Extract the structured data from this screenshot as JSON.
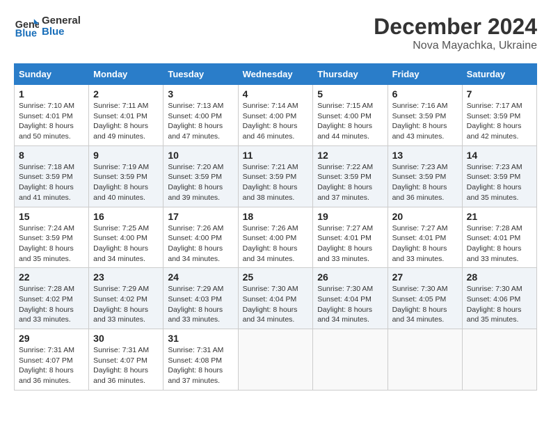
{
  "header": {
    "logo_line1": "General",
    "logo_line2": "Blue",
    "month_year": "December 2024",
    "location": "Nova Mayachka, Ukraine"
  },
  "weekdays": [
    "Sunday",
    "Monday",
    "Tuesday",
    "Wednesday",
    "Thursday",
    "Friday",
    "Saturday"
  ],
  "weeks": [
    [
      {
        "day": "1",
        "sunrise": "Sunrise: 7:10 AM",
        "sunset": "Sunset: 4:01 PM",
        "daylight": "Daylight: 8 hours and 50 minutes."
      },
      {
        "day": "2",
        "sunrise": "Sunrise: 7:11 AM",
        "sunset": "Sunset: 4:01 PM",
        "daylight": "Daylight: 8 hours and 49 minutes."
      },
      {
        "day": "3",
        "sunrise": "Sunrise: 7:13 AM",
        "sunset": "Sunset: 4:00 PM",
        "daylight": "Daylight: 8 hours and 47 minutes."
      },
      {
        "day": "4",
        "sunrise": "Sunrise: 7:14 AM",
        "sunset": "Sunset: 4:00 PM",
        "daylight": "Daylight: 8 hours and 46 minutes."
      },
      {
        "day": "5",
        "sunrise": "Sunrise: 7:15 AM",
        "sunset": "Sunset: 4:00 PM",
        "daylight": "Daylight: 8 hours and 44 minutes."
      },
      {
        "day": "6",
        "sunrise": "Sunrise: 7:16 AM",
        "sunset": "Sunset: 3:59 PM",
        "daylight": "Daylight: 8 hours and 43 minutes."
      },
      {
        "day": "7",
        "sunrise": "Sunrise: 7:17 AM",
        "sunset": "Sunset: 3:59 PM",
        "daylight": "Daylight: 8 hours and 42 minutes."
      }
    ],
    [
      {
        "day": "8",
        "sunrise": "Sunrise: 7:18 AM",
        "sunset": "Sunset: 3:59 PM",
        "daylight": "Daylight: 8 hours and 41 minutes."
      },
      {
        "day": "9",
        "sunrise": "Sunrise: 7:19 AM",
        "sunset": "Sunset: 3:59 PM",
        "daylight": "Daylight: 8 hours and 40 minutes."
      },
      {
        "day": "10",
        "sunrise": "Sunrise: 7:20 AM",
        "sunset": "Sunset: 3:59 PM",
        "daylight": "Daylight: 8 hours and 39 minutes."
      },
      {
        "day": "11",
        "sunrise": "Sunrise: 7:21 AM",
        "sunset": "Sunset: 3:59 PM",
        "daylight": "Daylight: 8 hours and 38 minutes."
      },
      {
        "day": "12",
        "sunrise": "Sunrise: 7:22 AM",
        "sunset": "Sunset: 3:59 PM",
        "daylight": "Daylight: 8 hours and 37 minutes."
      },
      {
        "day": "13",
        "sunrise": "Sunrise: 7:23 AM",
        "sunset": "Sunset: 3:59 PM",
        "daylight": "Daylight: 8 hours and 36 minutes."
      },
      {
        "day": "14",
        "sunrise": "Sunrise: 7:23 AM",
        "sunset": "Sunset: 3:59 PM",
        "daylight": "Daylight: 8 hours and 35 minutes."
      }
    ],
    [
      {
        "day": "15",
        "sunrise": "Sunrise: 7:24 AM",
        "sunset": "Sunset: 3:59 PM",
        "daylight": "Daylight: 8 hours and 35 minutes."
      },
      {
        "day": "16",
        "sunrise": "Sunrise: 7:25 AM",
        "sunset": "Sunset: 4:00 PM",
        "daylight": "Daylight: 8 hours and 34 minutes."
      },
      {
        "day": "17",
        "sunrise": "Sunrise: 7:26 AM",
        "sunset": "Sunset: 4:00 PM",
        "daylight": "Daylight: 8 hours and 34 minutes."
      },
      {
        "day": "18",
        "sunrise": "Sunrise: 7:26 AM",
        "sunset": "Sunset: 4:00 PM",
        "daylight": "Daylight: 8 hours and 34 minutes."
      },
      {
        "day": "19",
        "sunrise": "Sunrise: 7:27 AM",
        "sunset": "Sunset: 4:01 PM",
        "daylight": "Daylight: 8 hours and 33 minutes."
      },
      {
        "day": "20",
        "sunrise": "Sunrise: 7:27 AM",
        "sunset": "Sunset: 4:01 PM",
        "daylight": "Daylight: 8 hours and 33 minutes."
      },
      {
        "day": "21",
        "sunrise": "Sunrise: 7:28 AM",
        "sunset": "Sunset: 4:01 PM",
        "daylight": "Daylight: 8 hours and 33 minutes."
      }
    ],
    [
      {
        "day": "22",
        "sunrise": "Sunrise: 7:28 AM",
        "sunset": "Sunset: 4:02 PM",
        "daylight": "Daylight: 8 hours and 33 minutes."
      },
      {
        "day": "23",
        "sunrise": "Sunrise: 7:29 AM",
        "sunset": "Sunset: 4:02 PM",
        "daylight": "Daylight: 8 hours and 33 minutes."
      },
      {
        "day": "24",
        "sunrise": "Sunrise: 7:29 AM",
        "sunset": "Sunset: 4:03 PM",
        "daylight": "Daylight: 8 hours and 33 minutes."
      },
      {
        "day": "25",
        "sunrise": "Sunrise: 7:30 AM",
        "sunset": "Sunset: 4:04 PM",
        "daylight": "Daylight: 8 hours and 34 minutes."
      },
      {
        "day": "26",
        "sunrise": "Sunrise: 7:30 AM",
        "sunset": "Sunset: 4:04 PM",
        "daylight": "Daylight: 8 hours and 34 minutes."
      },
      {
        "day": "27",
        "sunrise": "Sunrise: 7:30 AM",
        "sunset": "Sunset: 4:05 PM",
        "daylight": "Daylight: 8 hours and 34 minutes."
      },
      {
        "day": "28",
        "sunrise": "Sunrise: 7:30 AM",
        "sunset": "Sunset: 4:06 PM",
        "daylight": "Daylight: 8 hours and 35 minutes."
      }
    ],
    [
      {
        "day": "29",
        "sunrise": "Sunrise: 7:31 AM",
        "sunset": "Sunset: 4:07 PM",
        "daylight": "Daylight: 8 hours and 36 minutes."
      },
      {
        "day": "30",
        "sunrise": "Sunrise: 7:31 AM",
        "sunset": "Sunset: 4:07 PM",
        "daylight": "Daylight: 8 hours and 36 minutes."
      },
      {
        "day": "31",
        "sunrise": "Sunrise: 7:31 AM",
        "sunset": "Sunset: 4:08 PM",
        "daylight": "Daylight: 8 hours and 37 minutes."
      },
      null,
      null,
      null,
      null
    ]
  ]
}
